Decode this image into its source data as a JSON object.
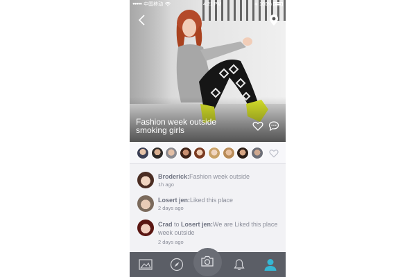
{
  "status_bar": {
    "carrier": "中国移动",
    "time": "4:21 PM",
    "battery": "100%"
  },
  "post": {
    "title": "Fashion week outside smoking girls"
  },
  "likers_count": 9,
  "activity": [
    {
      "user": "Broderick:",
      "text": "Fashion week outside",
      "time": "1h ago"
    },
    {
      "user": "Losert jen:",
      "text": "Liked this place",
      "time": "2 days ago"
    },
    {
      "user": "Crad",
      "connector": " to ",
      "target": "Losert jen:",
      "text": "We are Liked this place week outside",
      "time": "2 days ago"
    }
  ],
  "tabbar": {
    "items": [
      "gallery-icon",
      "compass-icon",
      "camera-icon",
      "bell-icon",
      "profile-icon"
    ],
    "active": "profile-icon",
    "active_color": "#35b7d4"
  },
  "colors": {
    "tabbar_bg": "#5b5e66",
    "panel_bg": "#f2f2f5",
    "text": "#8a8d99"
  }
}
